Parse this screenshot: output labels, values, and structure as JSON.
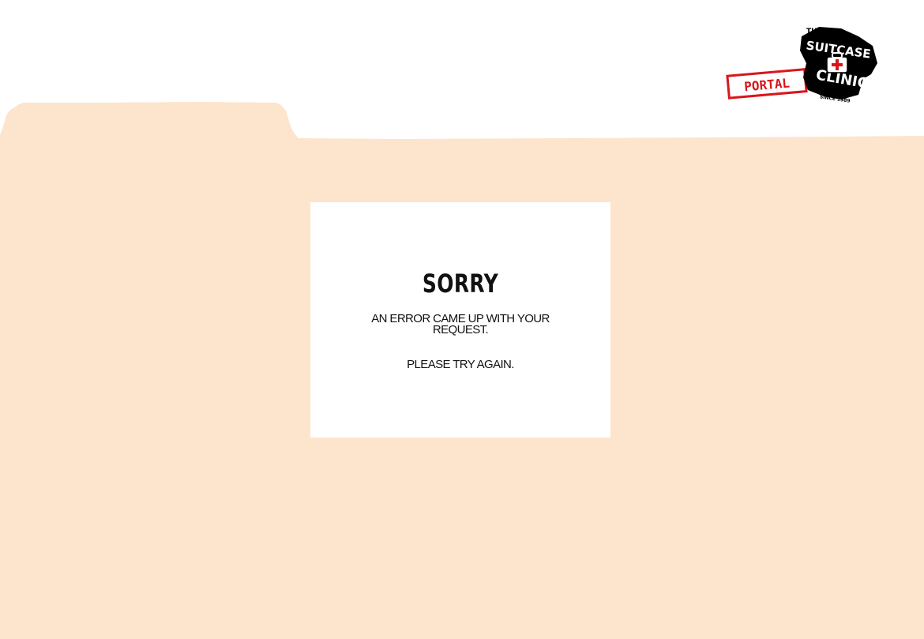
{
  "brand": {
    "logo_text_top": "THE",
    "logo_text_main_1": "SUITCASE",
    "logo_text_main_2": "CLINIC",
    "logo_text_since": "SINCE 1989",
    "stamp_text": "PORTAL",
    "stamp_color": "#d9161c"
  },
  "colors": {
    "folder": "#fde4cc",
    "card": "#ffffff",
    "text": "#111111"
  },
  "error": {
    "title": "SORRY",
    "message": "AN ERROR CAME UP WITH YOUR REQUEST.",
    "retry": "PLEASE TRY AGAIN."
  }
}
